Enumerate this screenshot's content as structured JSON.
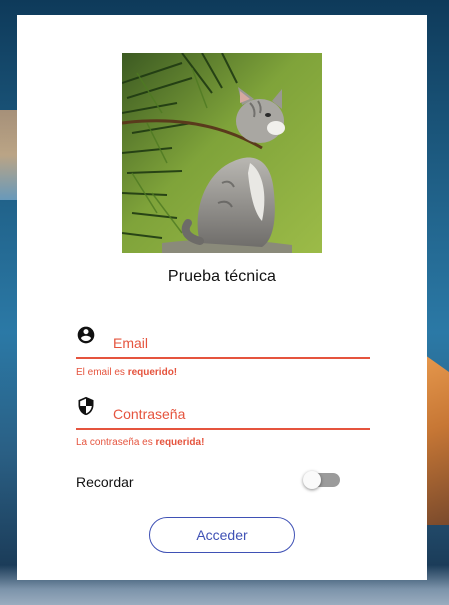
{
  "login_card": {
    "image_alt": "kitten",
    "title": "Prueba técnica",
    "email": {
      "icon": "account-circle-icon",
      "placeholder": "Email",
      "value": "",
      "error_prefix": "El email es ",
      "error_emphasis": "requerido!"
    },
    "password": {
      "icon": "shield-icon",
      "placeholder": "Contraseña",
      "value": "",
      "error_prefix": "La contraseña es ",
      "error_emphasis": "requerida!"
    },
    "remember": {
      "label": "Recordar",
      "checked": false
    },
    "submit_label": "Acceder"
  },
  "colors": {
    "error": "#e5543e",
    "primary": "#3f51b5",
    "card_bg": "#ffffff",
    "toggle_track": "#9b9b9b"
  }
}
